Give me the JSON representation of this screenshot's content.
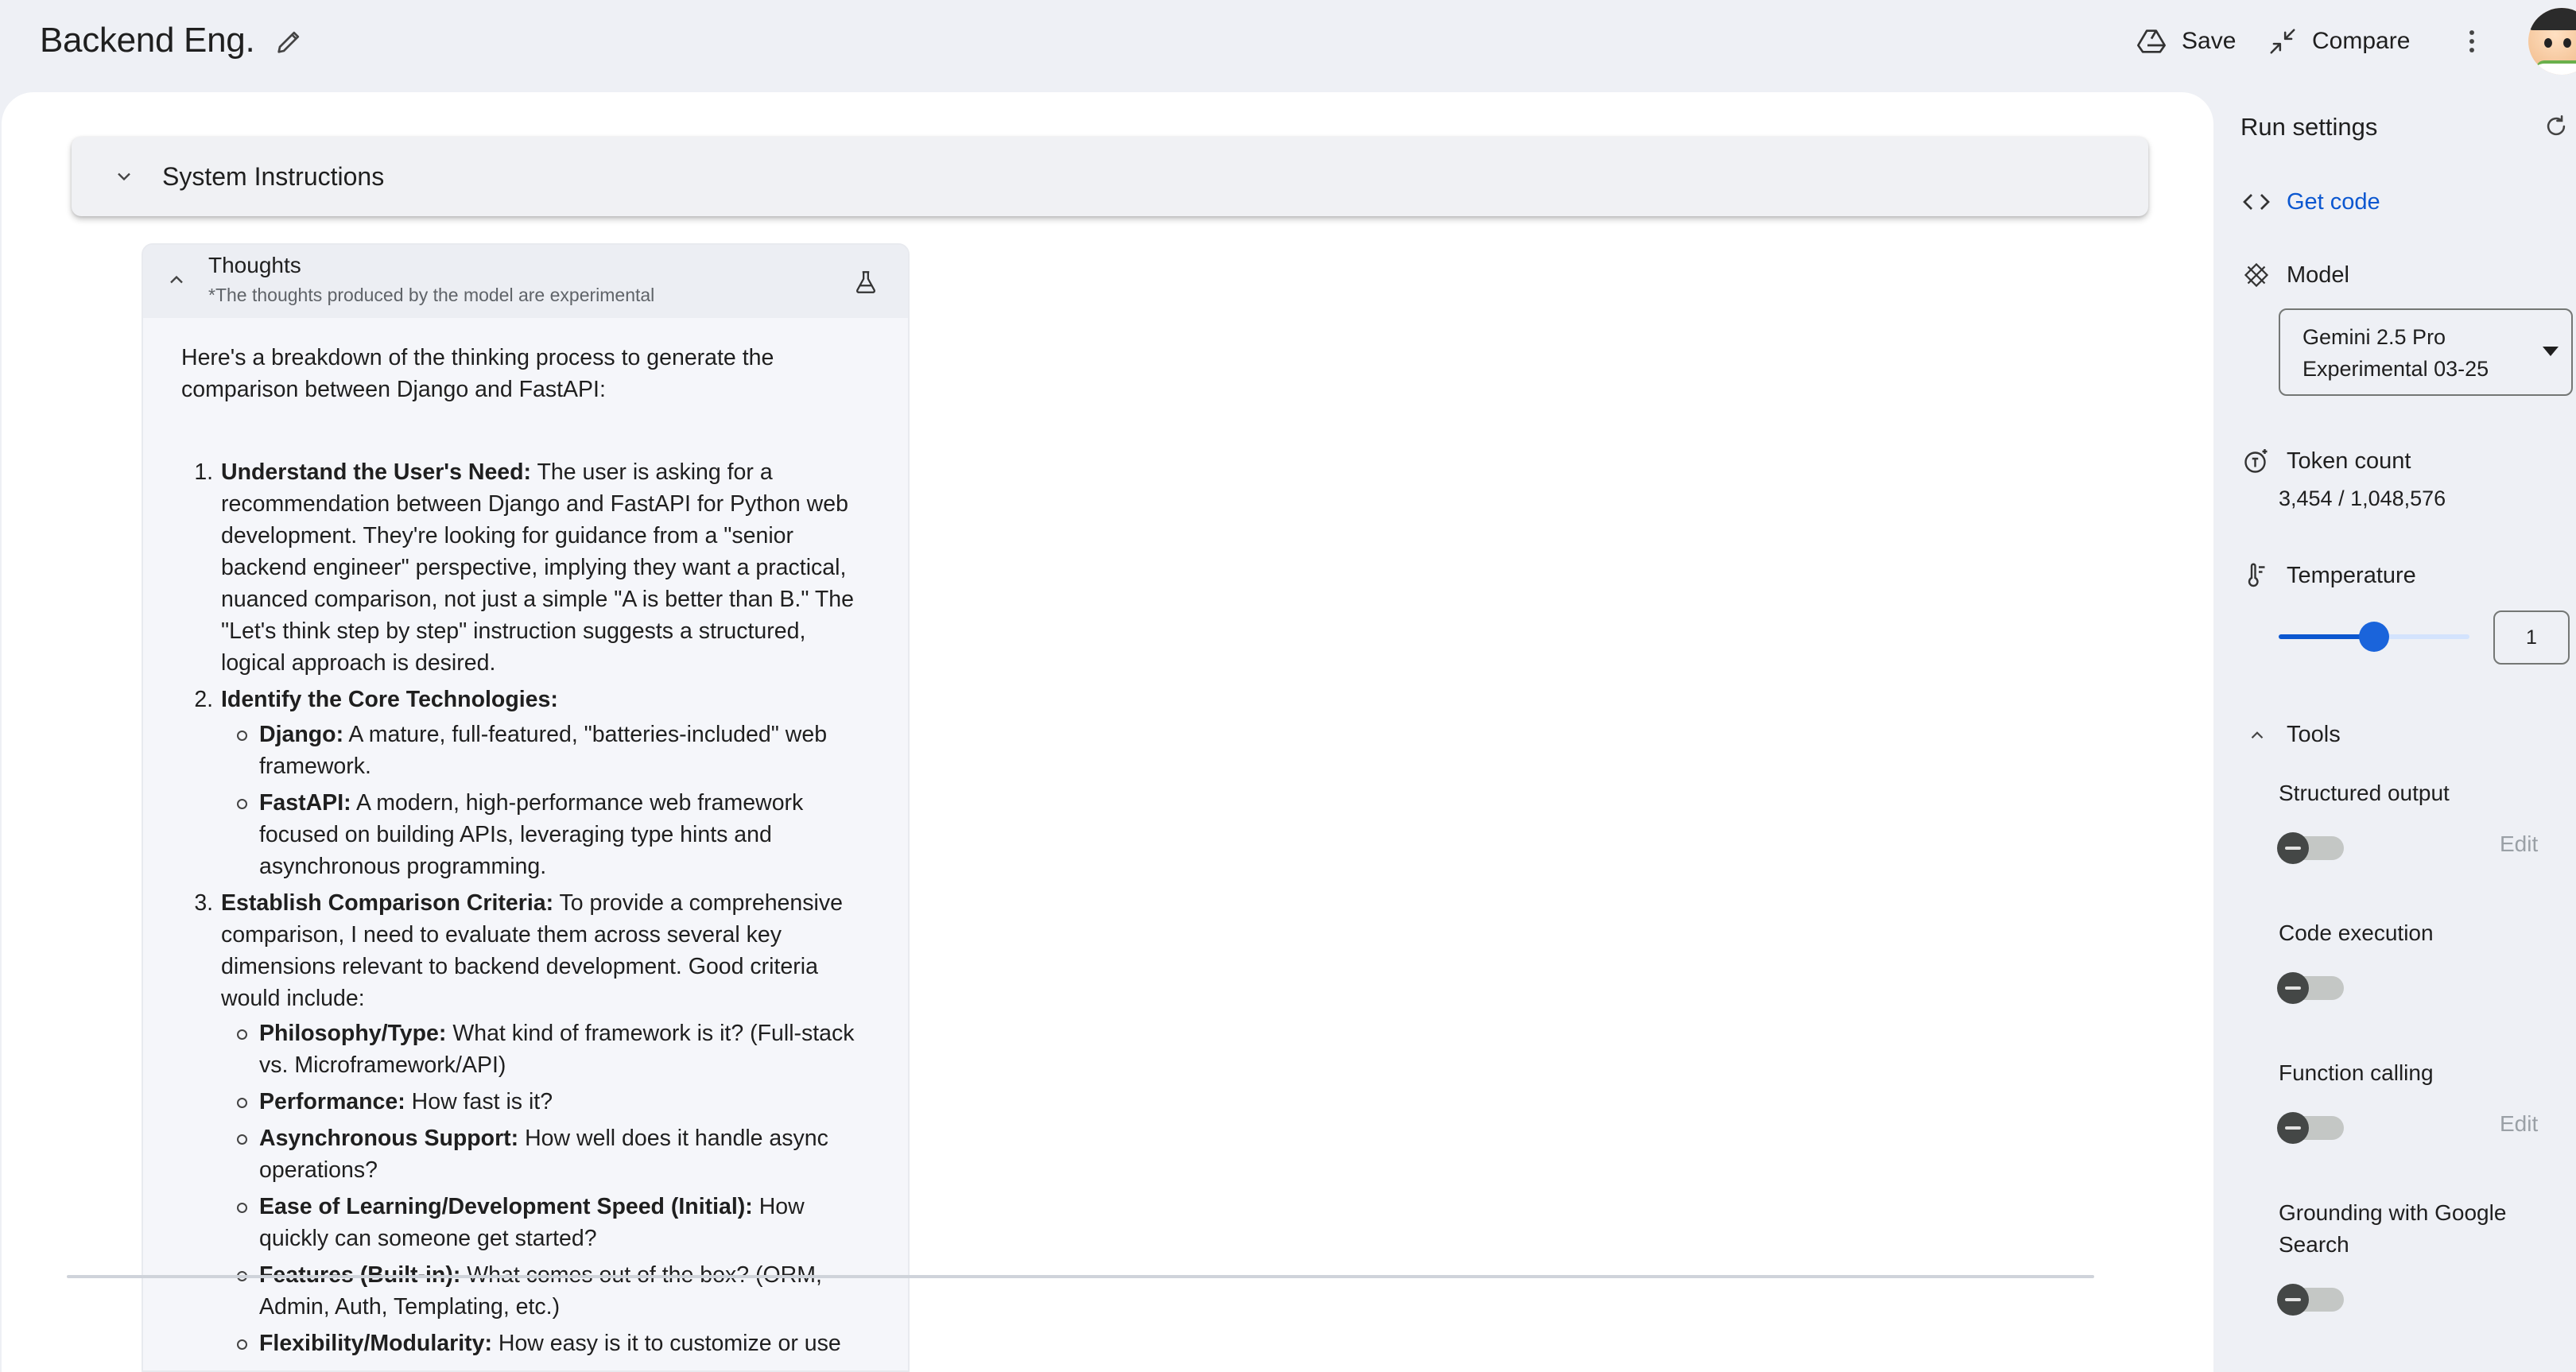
{
  "header": {
    "title": "Backend Eng.",
    "save_label": "Save",
    "compare_label": "Compare"
  },
  "system_instructions": {
    "label": "System Instructions"
  },
  "thoughts": {
    "title": "Thoughts",
    "subtitle": "*The thoughts produced by the model are experimental",
    "intro": "Here's a breakdown of the thinking process to generate the comparison between Django and FastAPI:",
    "steps": [
      {
        "heading": "Understand the User's Need:",
        "text": " The user is asking for a recommendation between Django and FastAPI for Python web development. They're looking for guidance from a \"senior backend engineer\" perspective, implying they want a practical, nuanced comparison, not just a simple \"A is better than B.\" The \"Let's think step by step\" instruction suggests a structured, logical approach is desired."
      },
      {
        "heading": "Identify the Core Technologies:",
        "text": "",
        "bullets": [
          {
            "term": "Django:",
            "text": " A mature, full-featured, \"batteries-included\" web framework."
          },
          {
            "term": "FastAPI:",
            "text": " A modern, high-performance web framework focused on building APIs, leveraging type hints and asynchronous programming."
          }
        ]
      },
      {
        "heading": "Establish Comparison Criteria:",
        "text": " To provide a comprehensive comparison, I need to evaluate them across several key dimensions relevant to backend development. Good criteria would include:",
        "bullets": [
          {
            "term": "Philosophy/Type:",
            "text": " What kind of framework is it? (Full-stack vs. Microframework/API)"
          },
          {
            "term": "Performance:",
            "text": " How fast is it?"
          },
          {
            "term": "Asynchronous Support:",
            "text": " How well does it handle async operations?"
          },
          {
            "term": "Ease of Learning/Development Speed (Initial):",
            "text": " How quickly can someone get started?"
          },
          {
            "term": "Features (Built-in):",
            "text": " What comes out of the box? (ORM, Admin, Auth, Templating, etc.)"
          },
          {
            "term": "Flexibility/Modularity:",
            "text": " How easy is it to customize or use"
          }
        ]
      }
    ]
  },
  "settings": {
    "title": "Run settings",
    "get_code_label": "Get code",
    "model_label": "Model",
    "model_value_line1": "Gemini 2.5 Pro",
    "model_value_line2": "Experimental 03-25",
    "token_label": "Token count",
    "token_value": "3,454 / 1,048,576",
    "temperature_label": "Temperature",
    "temperature_value": "1",
    "temperature_fraction": 0.5,
    "tools_label": "Tools",
    "tools": [
      {
        "label": "Structured output",
        "edit": "Edit",
        "enabled": false
      },
      {
        "label": "Code execution",
        "edit": "",
        "enabled": false
      },
      {
        "label": "Function calling",
        "edit": "Edit",
        "enabled": false
      },
      {
        "label": "Grounding with Google Search",
        "edit": "",
        "enabled": false
      }
    ]
  },
  "colors": {
    "accent": "#0b57d0",
    "page_bg": "#eef0f5"
  }
}
